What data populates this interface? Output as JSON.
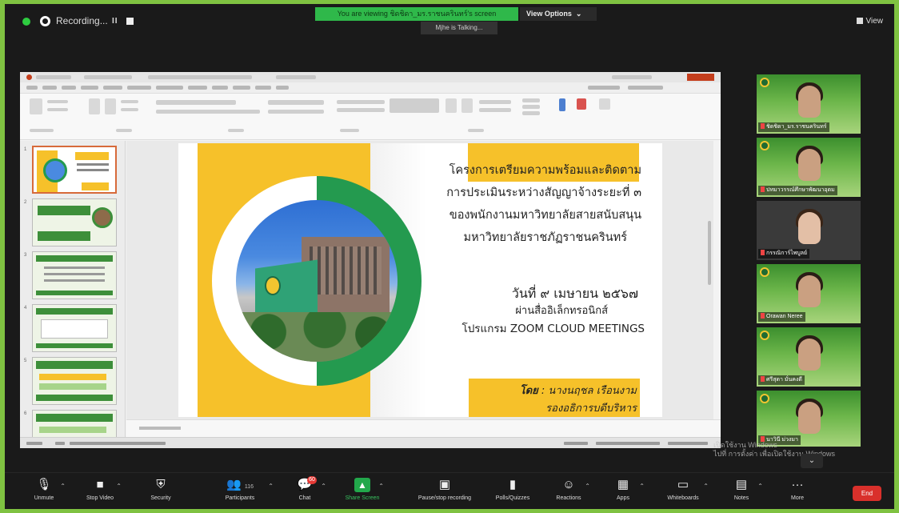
{
  "top_bar": {
    "recording_label": "Recording...",
    "pause_label": "II",
    "share_banner": "You are viewing ชิดชิดา_มร.ราชนครินทร์'s screen",
    "view_options": "View Options",
    "view_options_caret": "⌄",
    "speaking": "Mjhe is Talking...",
    "view_label": "View"
  },
  "slide": {
    "title_lines": [
      "โครงการเตรียมความพร้อมและติดตาม",
      "การประเมินระหว่างสัญญาจ้างระยะที่ ๓",
      "ของพนักงานมหาวิทยาลัยสายสนับสนุน",
      "มหาวิทยาลัยราชภัฏราชนครินทร์"
    ],
    "date_line": "วันที่ ๙ เมษายน ๒๕๖๗",
    "via_line": "ผ่านสื่ออิเล็กทรอนิกส์",
    "program_line": "โปรแกรม ZOOM CLOUD MEETINGS",
    "by_prefix": "โดย",
    "by_name": ": นางนฤชล เรือนงาม",
    "by_title": "รองอธิการบดีบริหาร"
  },
  "ppt": {
    "thumb_numbers": [
      "1",
      "2",
      "3",
      "4",
      "5",
      "6"
    ]
  },
  "participants": [
    {
      "name": "ชิดชิดา_มร.ราชนครินทร์"
    },
    {
      "name": "ปทมาวรรณ์ศึกษาพัฒนาอุดม"
    },
    {
      "name": "กรรณิการ์ไพบูลย์"
    },
    {
      "name": "Orawan Neree"
    },
    {
      "name": "ศรีสุดา มั่นคงดี"
    },
    {
      "name": "นาวินี ม่วงมา"
    }
  ],
  "watermark": {
    "line1": "เปิดใช้งาน Windows",
    "line2": "ไปที่ การตั้งค่า เพื่อเปิดใช้งาน Windows"
  },
  "toolbar": {
    "unmute": "Unmute",
    "stop_video": "Stop Video",
    "security": "Security",
    "participants": "Participants",
    "participants_count": "116",
    "chat": "Chat",
    "chat_badge": "60",
    "share_screen": "Share Screen",
    "recording": "Pause/stop recording",
    "polls": "Polls/Quizzes",
    "reactions": "Reactions",
    "apps": "Apps",
    "whiteboards": "Whiteboards",
    "notes": "Notes",
    "more": "More",
    "more_icon": "···",
    "caret": "⌃",
    "tray_caret": "⌄",
    "end": "End"
  },
  "icons": {
    "mic": "🎙",
    "video": "■",
    "security": "⛨",
    "participants": "👥",
    "chat": "💬",
    "share": "▲",
    "record": "▣",
    "polls": "▮",
    "reactions": "☺",
    "apps": "▦",
    "whiteboard": "▭",
    "notes": "▤"
  }
}
